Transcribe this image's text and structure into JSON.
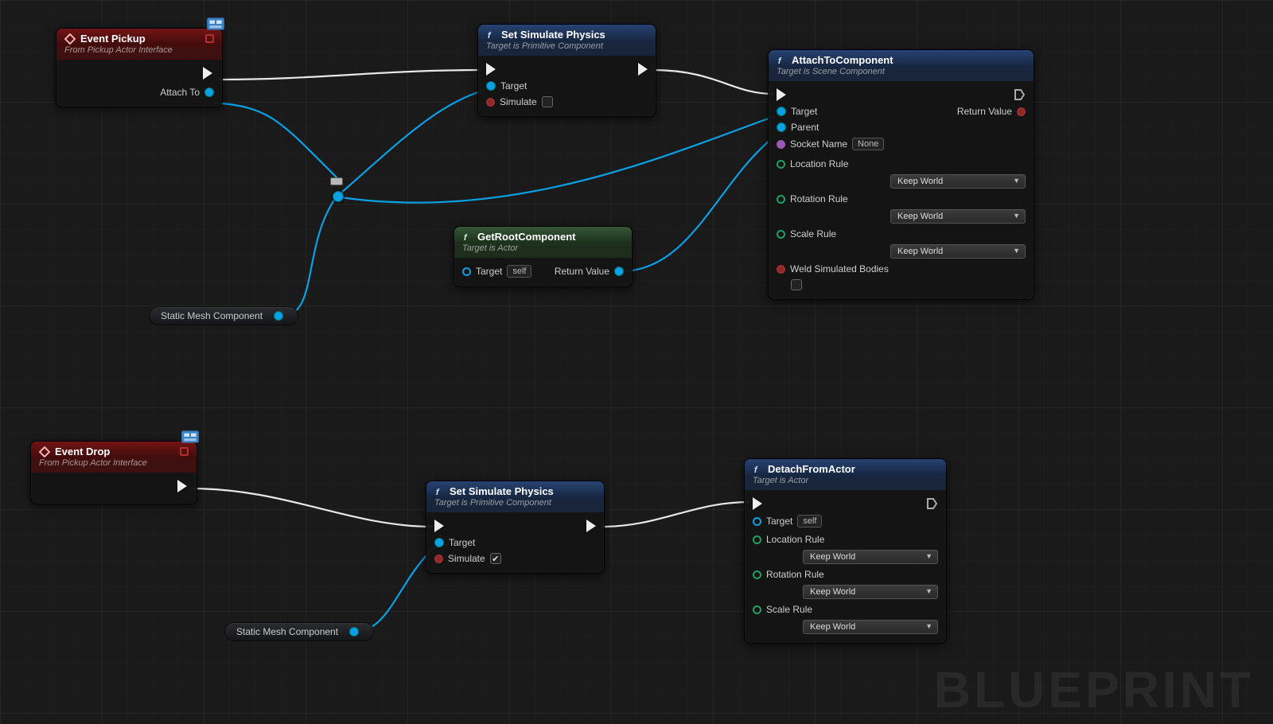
{
  "watermark": "BLUEPRINT",
  "nodes": {
    "event_pickup": {
      "title": "Event Pickup",
      "subtitle": "From Pickup Actor Interface",
      "out_attach": "Attach To"
    },
    "event_drop": {
      "title": "Event Drop",
      "subtitle": "From Pickup Actor Interface"
    },
    "simphys1": {
      "title": "Set Simulate Physics",
      "subtitle": "Target is Primitive Component",
      "target": "Target",
      "simulate": "Simulate",
      "simulate_checked": false
    },
    "simphys2": {
      "title": "Set Simulate Physics",
      "subtitle": "Target is Primitive Component",
      "target": "Target",
      "simulate": "Simulate",
      "simulate_checked": true
    },
    "getroot": {
      "title": "GetRootComponent",
      "subtitle": "Target is Actor",
      "target": "Target",
      "target_val": "self",
      "return": "Return Value"
    },
    "attach": {
      "title": "AttachToComponent",
      "subtitle": "Target is Scene Component",
      "target": "Target",
      "parent": "Parent",
      "socket": "Socket Name",
      "socket_val": "None",
      "loc_rule": "Location Rule",
      "loc_val": "Keep World",
      "rot_rule": "Rotation Rule",
      "rot_val": "Keep World",
      "scale_rule": "Scale Rule",
      "scale_val": "Keep World",
      "weld": "Weld Simulated Bodies",
      "weld_checked": false,
      "return": "Return Value"
    },
    "detach": {
      "title": "DetachFromActor",
      "subtitle": "Target is Actor",
      "target": "Target",
      "target_val": "self",
      "loc_rule": "Location Rule",
      "loc_val": "Keep World",
      "rot_rule": "Rotation Rule",
      "rot_val": "Keep World",
      "scale_rule": "Scale Rule",
      "scale_val": "Keep World"
    },
    "static1": "Static Mesh Component",
    "static2": "Static Mesh Component"
  },
  "colors": {
    "exec_wire": "#e8e8e8",
    "data_wire": "#0aa0e6",
    "event_header": "#7a1c1c",
    "func_header": "#2a4a78",
    "pure_header": "#3a5b3a"
  }
}
